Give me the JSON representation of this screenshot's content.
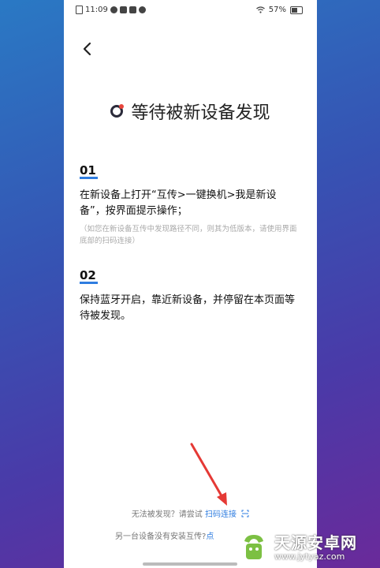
{
  "status_bar": {
    "time": "11:09",
    "battery": "57%"
  },
  "page": {
    "title": "等待被新设备发现"
  },
  "steps": [
    {
      "number": "01",
      "text": "在新设备上打开“互传>一键换机>我是新设备”，按界面提示操作；",
      "note": "（如您在新设备互传中发现路径不同，则其为低版本，请使用界面底部的扫码连接）"
    },
    {
      "number": "02",
      "text": "保持蓝牙开启，靠近新设备，并停留在本页面等待被发现。"
    }
  ],
  "bottom": {
    "prompt": "无法被发现？请尝试",
    "scan_link": "扫码连接",
    "install_prompt": "另一台设备没有安装互传?",
    "install_link": "点"
  },
  "watermark": {
    "title": "天源安卓网",
    "url": "www.jytyaz.com"
  },
  "colors": {
    "accent": "#2f7de0",
    "arrow": "#e53935",
    "background_gradient": [
      "#2a79c4",
      "#4a3aa8",
      "#6a2a9a"
    ]
  }
}
